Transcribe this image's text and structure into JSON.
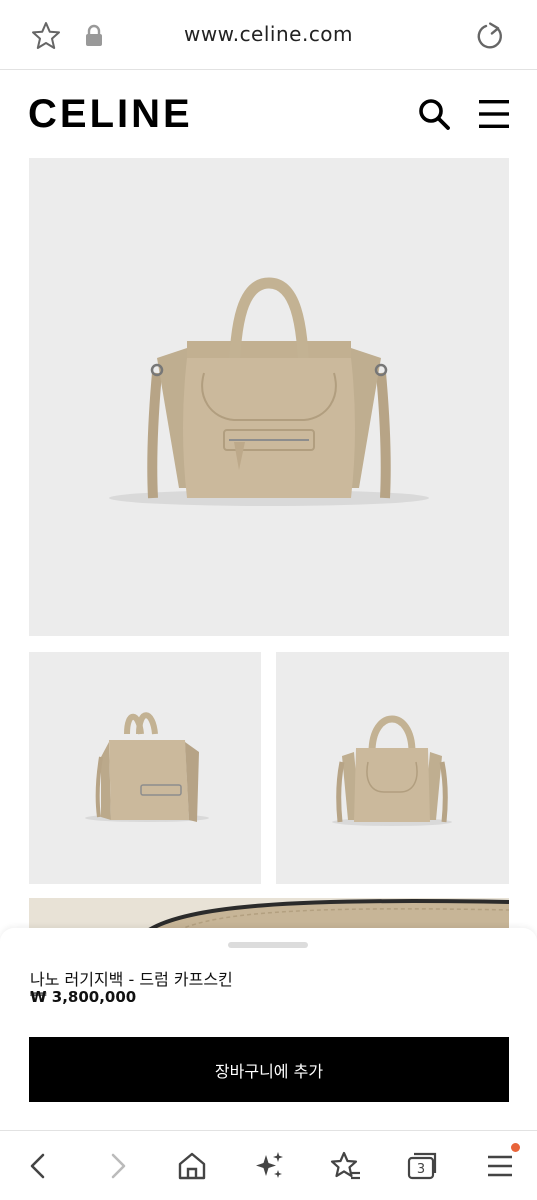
{
  "browser": {
    "url": "www.celine.com",
    "icons": [
      "star-outline-icon",
      "lock-icon",
      "reload-icon"
    ]
  },
  "site": {
    "logo": "CELINE",
    "icons": [
      "search-icon",
      "hamburger-menu-icon"
    ]
  },
  "product": {
    "name": "나노 러기지백 - 드럼 카프스킨",
    "price": "₩ 3,800,000",
    "add_to_cart_label": "장바구니에 추가",
    "image_bg": "#ececec",
    "bag_color": "#c9b79a"
  },
  "bottom_nav": {
    "tab_count": "3",
    "icons": [
      "back-icon",
      "forward-icon",
      "home-icon",
      "sparkle-icon",
      "bookmarks-icon",
      "tabs-icon",
      "menu-icon"
    ],
    "badge_color": "#e8643a"
  }
}
